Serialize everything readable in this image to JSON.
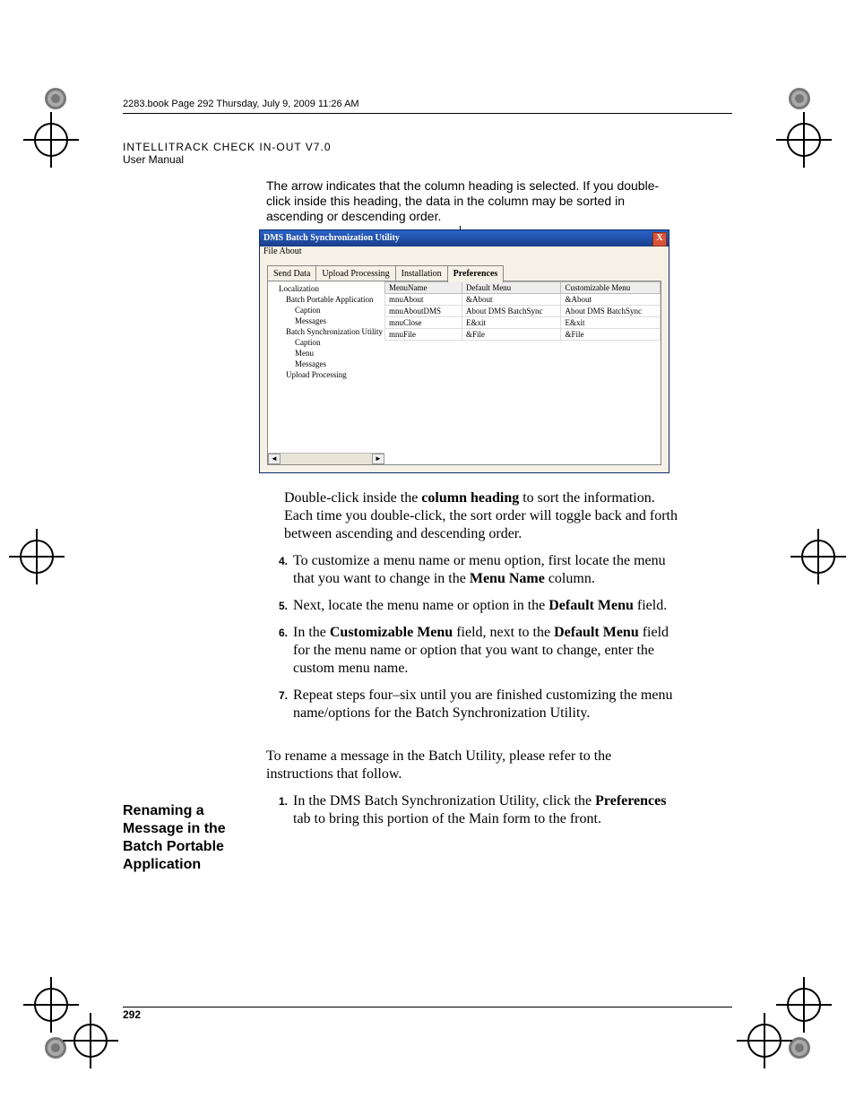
{
  "bookheader": "2283.book  Page 292  Thursday, July 9, 2009  11:26 AM",
  "runninghead_line1": "INTELLITRACK CHECK IN-OUT V7.0",
  "runninghead_line2": "User Manual",
  "lead_paragraph": "The arrow indicates that the column heading is selected. If you double-click inside this heading, the data in the column may be sorted in ascending or descending order.",
  "screenshot": {
    "title": "DMS Batch Synchronization Utility",
    "close": "X",
    "menubar": "File   About",
    "tabs": [
      "Send Data",
      "Upload Processing",
      "Installation",
      "Preferences"
    ],
    "active_tab_index": 3,
    "tree": {
      "root": "Localization",
      "n1": "Batch Portable Application",
      "n1a": "Caption",
      "n1b": "Messages",
      "n2": "Batch Synchronization Utility",
      "n2a": "Caption",
      "n2b": "Menu",
      "n2c": "Messages",
      "n3": "Upload Processing"
    },
    "grid": {
      "headers": [
        "MenuName",
        "Default Menu",
        "Customizable Menu"
      ],
      "rows": [
        [
          "mnuAbout",
          "&About",
          "&About"
        ],
        [
          "mnuAboutDMS",
          "About DMS BatchSync",
          "About DMS BatchSync"
        ],
        [
          "mnuClose",
          "E&xit",
          "E&xit"
        ],
        [
          "mnuFile",
          "&File",
          "&File"
        ]
      ]
    },
    "scroll_left": "◄",
    "scroll_right": "►"
  },
  "after_shot_para_pre": "Double-click inside the ",
  "after_shot_para_bold": "column heading",
  "after_shot_para_post": " to sort the information. Each time you double-click, the sort order will toggle back and forth between ascending and descending order.",
  "steps": {
    "s4": {
      "n": "4.",
      "pre": "To customize a menu name or menu option, first locate the menu that you want to change in the ",
      "b1": "Menu Name",
      "post": " column."
    },
    "s5": {
      "n": "5.",
      "pre": "Next, locate the menu name or option in the ",
      "b1": "Default Menu",
      "post": " field."
    },
    "s6": {
      "n": "6.",
      "pre": "In the ",
      "b1": "Customizable Menu",
      "mid": " field, next to the ",
      "b2": "Default Menu",
      "post": " field for the menu name or option that you want to change, enter the custom menu name."
    },
    "s7": {
      "n": "7.",
      "text": "Repeat steps four–six until you are finished customizing the menu name/options for the Batch Synchronization Utility."
    }
  },
  "sidehead": "Renaming a Message in the Batch Portable Application",
  "section2_para": "To rename a message in the Batch Utility, please refer to the instructions that follow.",
  "section2_step1": {
    "n": "1.",
    "pre": "In the DMS Batch Synchronization Utility, click the ",
    "b1": "Preferences",
    "post": " tab to bring this portion of the Main form to the front."
  },
  "pagenum": "292"
}
